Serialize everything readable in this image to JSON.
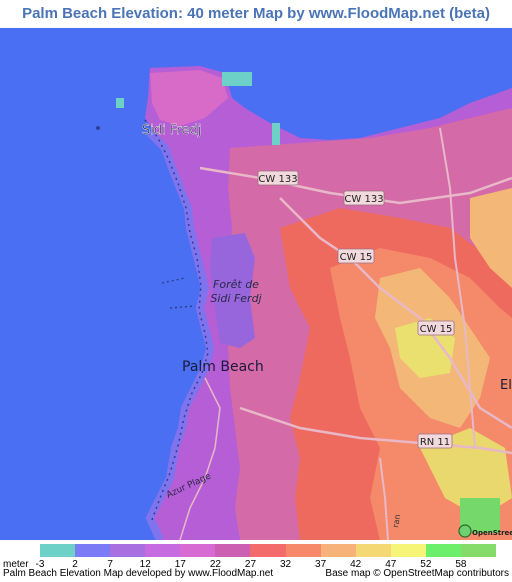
{
  "title": "Palm Beach Elevation: 40 meter Map by www.FloodMap.net (beta)",
  "map": {
    "places": {
      "sidi_fredj": "Sidi Fredj",
      "foret_line1": "Forêt de",
      "foret_line2": "Sidi Ferdj",
      "palm_beach": "Palm Beach",
      "azur_plage": "Azur Plage",
      "el": "El",
      "ran": "ran"
    },
    "roads": {
      "cw133_a": "CW 133",
      "cw133_b": "CW 133",
      "cw15_a": "CW 15",
      "cw15_b": "CW 15",
      "rn11": "RN 11"
    },
    "attribution_logo": "OpenStreetMap",
    "colors": {
      "sea": "#4b6ff2",
      "shore": "#6a6ff0",
      "low": "#b060d8",
      "mid_low": "#d86ac8",
      "mid": "#d46090",
      "mid_high": "#ee6860",
      "high": "#f58a6a",
      "higher": "#f5ba78",
      "top": "#eae070",
      "road_label_bg": "#f1d9de"
    }
  },
  "legend": {
    "unit_label": "meter",
    "ticks": [
      "-3",
      "2",
      "7",
      "12",
      "17",
      "22",
      "27",
      "32",
      "37",
      "42",
      "47",
      "52",
      "58"
    ],
    "colors": [
      "#6ed1c8",
      "#7b7bf5",
      "#a86fe0",
      "#c66be0",
      "#d86ad3",
      "#cd5fb3",
      "#f46b6b",
      "#f6896a",
      "#f7b27a",
      "#f4d874",
      "#f7f577",
      "#6cf06c",
      "#86dc6a"
    ]
  },
  "footer": {
    "left": "Palm Beach Elevation Map developed by www.FloodMap.net",
    "right": "Base map © OpenStreetMap contributors"
  }
}
